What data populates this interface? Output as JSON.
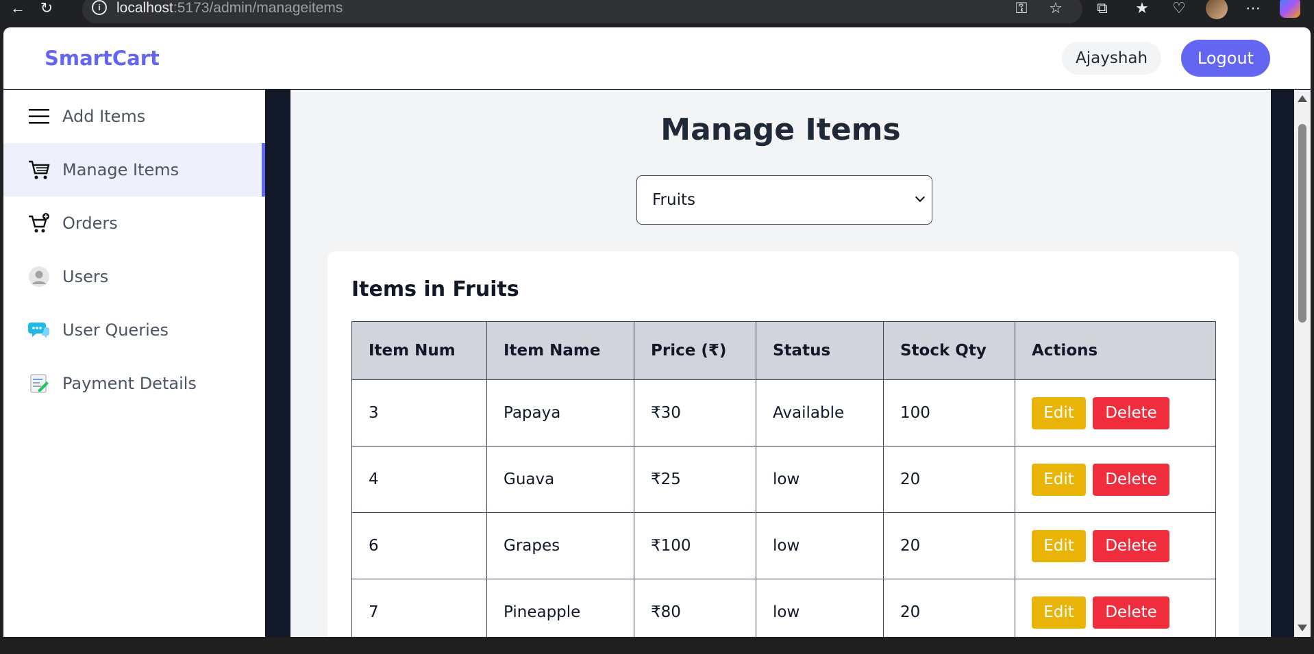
{
  "browser": {
    "url_host": "localhost",
    "url_path": ":5173/admin/manageitems"
  },
  "header": {
    "brand": "SmartCart",
    "username": "Ajayshah",
    "logout_label": "Logout"
  },
  "sidebar": {
    "items": [
      {
        "label": "Add Items",
        "icon": "menu-icon"
      },
      {
        "label": "Manage Items",
        "icon": "cart-icon",
        "active": true
      },
      {
        "label": "Orders",
        "icon": "cart-plus-icon"
      },
      {
        "label": "Users",
        "icon": "user-avatar-icon"
      },
      {
        "label": "User Queries",
        "icon": "chat-bubble-icon"
      },
      {
        "label": "Payment Details",
        "icon": "receipt-icon"
      }
    ]
  },
  "main": {
    "title": "Manage Items",
    "category_selected": "Fruits",
    "card_title": "Items in Fruits",
    "columns": [
      "Item Num",
      "Item Name",
      "Price (₹)",
      "Status",
      "Stock Qty",
      "Actions"
    ],
    "rows": [
      {
        "num": "3",
        "name": "Papaya",
        "price": "₹30",
        "status": "Available",
        "qty": "100"
      },
      {
        "num": "4",
        "name": "Guava",
        "price": "₹25",
        "status": "low",
        "qty": "20"
      },
      {
        "num": "6",
        "name": "Grapes",
        "price": "₹100",
        "status": "low",
        "qty": "20"
      },
      {
        "num": "7",
        "name": "Pineapple",
        "price": "₹80",
        "status": "low",
        "qty": "20"
      }
    ],
    "edit_label": "Edit",
    "delete_label": "Delete"
  },
  "colors": {
    "accent": "#6366f1",
    "edit": "#eab308",
    "delete": "#ef2d3c"
  }
}
